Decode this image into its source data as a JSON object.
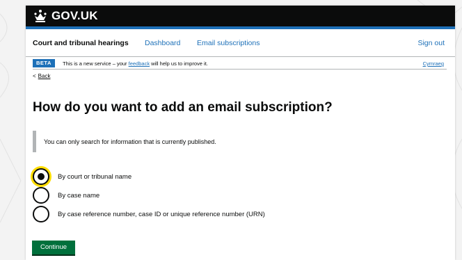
{
  "header": {
    "logo_text": "GOV.UK",
    "logo_icon": "crown-icon"
  },
  "nav": {
    "service_name": "Court and tribunal hearings",
    "dashboard": "Dashboard",
    "email_subscriptions": "Email subscriptions",
    "sign_out": "Sign out"
  },
  "phase_banner": {
    "tag": "BETA",
    "text_before": "This is a new service – your ",
    "link": "feedback",
    "text_after": " will help us to improve it.",
    "language_link": "Cymraeg"
  },
  "back_link": {
    "chevron": "<",
    "label": "Back"
  },
  "page": {
    "title": "How do you want to add an email subscription?",
    "inset_text": "You can only search for information that is currently published."
  },
  "options": [
    {
      "label": "By court or tribunal name",
      "checked": true
    },
    {
      "label": "By case name",
      "checked": false
    },
    {
      "label": "By case reference number, case ID or unique reference number (URN)",
      "checked": false
    }
  ],
  "continue_button": "Continue",
  "colors": {
    "header_bg": "#0b0c0c",
    "link_blue": "#1d70b8",
    "button_green": "#00703c",
    "focus_yellow": "#ffdd00"
  }
}
